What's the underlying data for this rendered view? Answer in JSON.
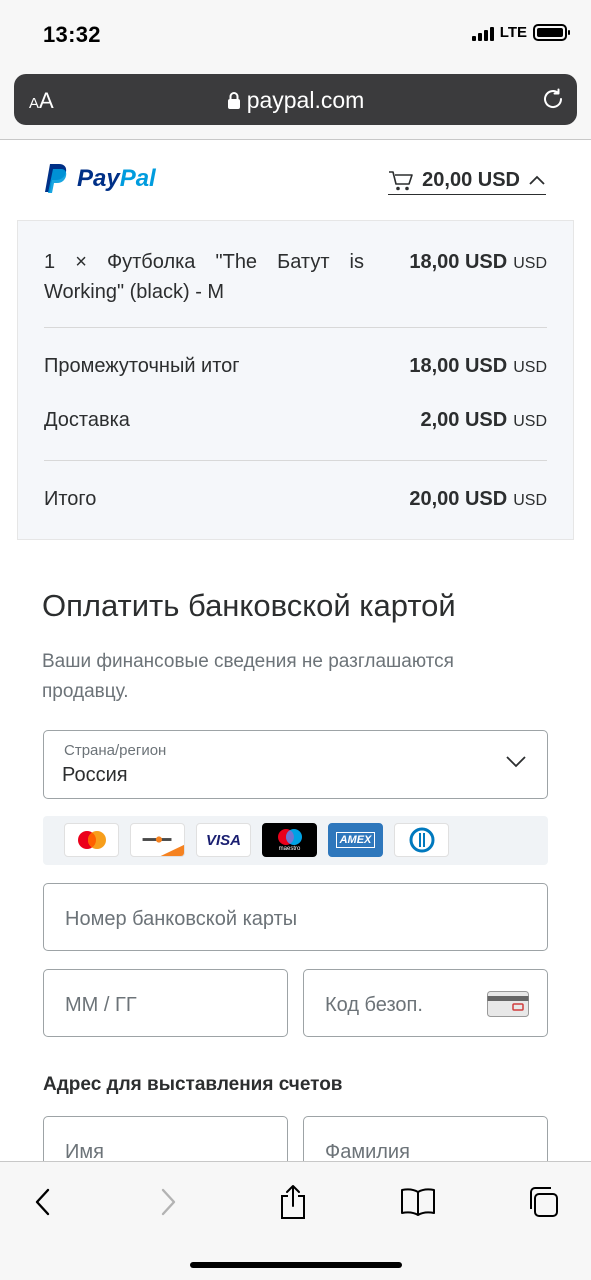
{
  "status": {
    "time": "13:32",
    "network": "LTE"
  },
  "browser": {
    "text_size_small": "A",
    "text_size_large": "A",
    "url": "paypal.com"
  },
  "header": {
    "logo_pay": "Pay",
    "logo_pal": "Pal",
    "cart_total": "20,00 USD"
  },
  "summary": {
    "item": {
      "name": "1 × Футболка \"The Батут is Working\" (black) - M",
      "amount": "18,00 USD",
      "currency": "USD"
    },
    "subtotal": {
      "label": "Промежуточный итог",
      "amount": "18,00 USD",
      "currency": "USD"
    },
    "shipping": {
      "label": "Доставка",
      "amount": "2,00 USD",
      "currency": "USD"
    },
    "total": {
      "label": "Итого",
      "amount": "20,00 USD",
      "currency": "USD"
    }
  },
  "form": {
    "title": "Оплатить банковской картой",
    "subtitle": "Ваши финансовые сведения не разглашаются продавцу.",
    "country_label": "Страна/регион",
    "country_value": "Россия",
    "card_brands": [
      "Mastercard",
      "Discover",
      "VISA",
      "maestro",
      "AMEX",
      "Diners"
    ],
    "card_number_placeholder": "Номер банковской карты",
    "expiry_placeholder": "ММ / ГГ",
    "cvv_placeholder": "Код безоп.",
    "billing_title": "Адрес для выставления счетов",
    "first_name_placeholder": "Имя",
    "last_name_placeholder": "Фамилия"
  },
  "colors": {
    "paypal_dark": "#003087",
    "paypal_light": "#009cde",
    "text": "#2c2e2f",
    "muted": "#6c7378"
  }
}
